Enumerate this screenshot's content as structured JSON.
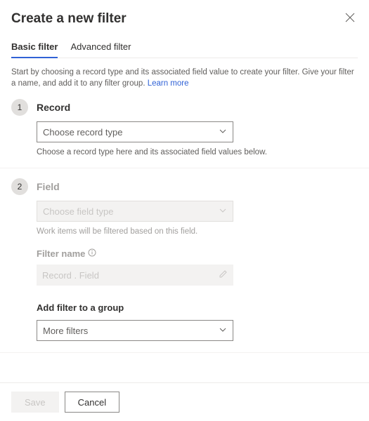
{
  "header": {
    "title": "Create a new filter"
  },
  "tabs": {
    "basic": "Basic filter",
    "advanced": "Advanced filter",
    "active": "basic"
  },
  "intro": {
    "text": "Start by choosing a record type and its associated field value to create your filter. Give your filter a name, and add it to any filter group. ",
    "link": "Learn more"
  },
  "step1": {
    "num": "1",
    "title": "Record",
    "placeholder": "Choose record type",
    "helper": "Choose a record type here and its associated field values below."
  },
  "step2": {
    "num": "2",
    "title": "Field",
    "placeholder": "Choose field type",
    "helper": "Work items will be filtered based on this field."
  },
  "filter_name": {
    "label": "Filter name",
    "placeholder": "Record . Field"
  },
  "group": {
    "label": "Add filter to a group",
    "value": "More filters"
  },
  "footer": {
    "save": "Save",
    "cancel": "Cancel"
  },
  "icons": {
    "close": "close-icon",
    "chevron": "chevron-down-icon",
    "info": "info-icon",
    "edit": "edit-icon"
  }
}
